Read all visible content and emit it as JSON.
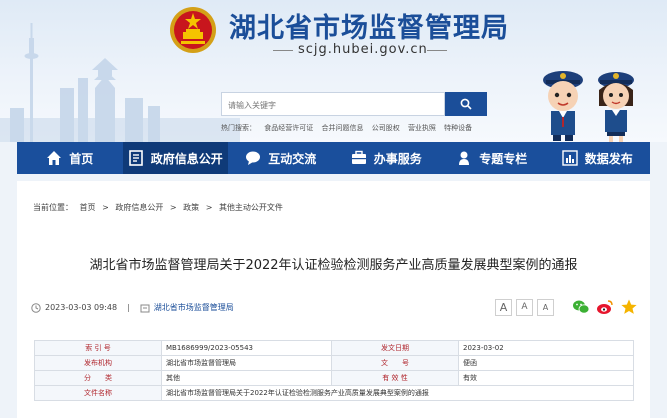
{
  "site": {
    "title": "湖北省市场监督管理局",
    "domain": "scjg.hubei.gov.cn"
  },
  "search": {
    "placeholder": "请输入关键字",
    "hotwords_label": "热门搜索：",
    "hotwords": [
      "食品经营许可证",
      "合并问题信息",
      "公司股权",
      "营业执照",
      "特种设备"
    ]
  },
  "nav": {
    "items": [
      {
        "label": "首页",
        "icon": "home-icon"
      },
      {
        "label": "政府信息公开",
        "icon": "document-icon"
      },
      {
        "label": "互动交流",
        "icon": "chat-icon"
      },
      {
        "label": "办事服务",
        "icon": "service-icon"
      },
      {
        "label": "专题专栏",
        "icon": "user-pin-icon"
      },
      {
        "label": "数据发布",
        "icon": "chart-icon"
      }
    ],
    "active_index": 1
  },
  "breadcrumb": {
    "label": "当前位置：",
    "items": [
      "首页",
      "政府信息公开",
      "政策",
      "其他主动公开文件"
    ],
    "separator": ">"
  },
  "article": {
    "title": "湖北省市场监督管理局关于2022年认证检验检测服务产业高质量发展典型案例的通报",
    "datetime": "2023-03-03 09:48",
    "meta_separator": "|",
    "source": "湖北省市场监督管理局"
  },
  "tools": {
    "font_sizes": [
      "A",
      "A",
      "A"
    ],
    "share": [
      "wechat-icon",
      "weibo-icon",
      "favorite-star-icon"
    ]
  },
  "info_table": {
    "rows": [
      {
        "label1": "索 引 号",
        "value1": "MB1686999/2023-05543",
        "label2": "发文日期",
        "value2": "2023-03-02"
      },
      {
        "label1": "发布机构",
        "value1": "湖北省市场监督管理局",
        "label2": "文　　号",
        "value2": "便函"
      },
      {
        "label1": "分　　类",
        "value1": "其他",
        "label2": "有 效 性",
        "value2": "有效"
      },
      {
        "label1": "文件名称",
        "value1": "湖北省市场监督管理局关于2022年认证检验检测服务产业高质量发展典型案例的通报",
        "label2": "",
        "value2": ""
      }
    ]
  },
  "colors": {
    "brand_blue": "#1b4e99",
    "nav_active": "#0f3a78",
    "label_red": "#b0262d"
  }
}
